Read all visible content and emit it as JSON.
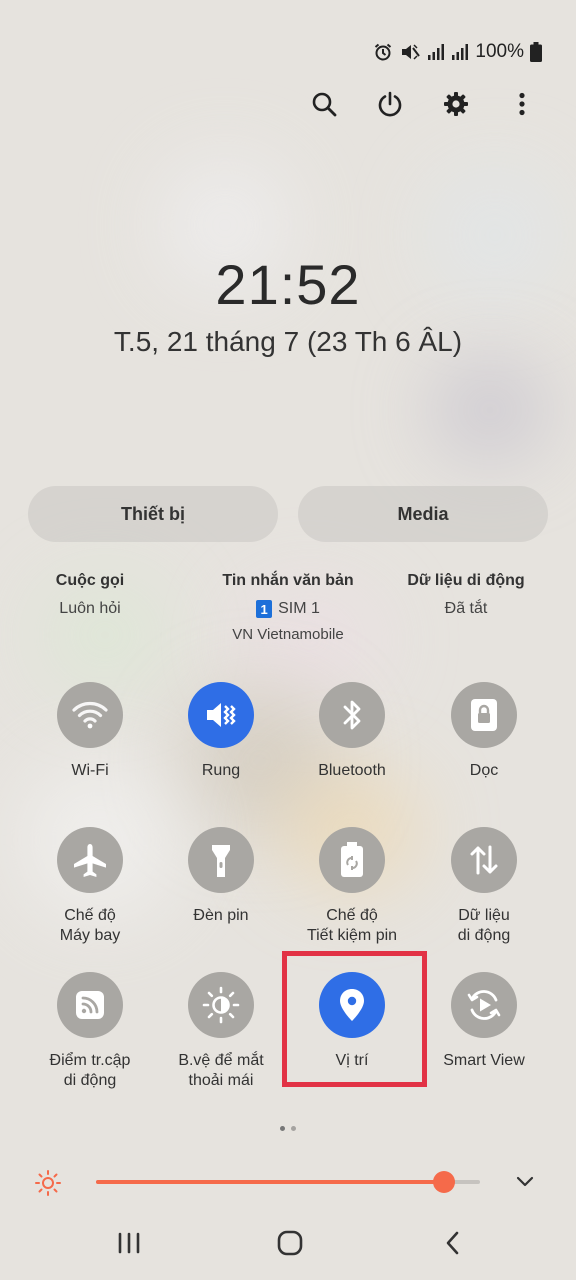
{
  "status": {
    "battery": "100%"
  },
  "clock": {
    "time": "21:52",
    "date": "T.5, 21 tháng 7 (23 Th 6 ÂL)"
  },
  "top_actions": [
    "search-icon",
    "power-icon",
    "gear-icon",
    "more-vert-icon"
  ],
  "tabs": {
    "devices": "Thiết bị",
    "media": "Media"
  },
  "sim_settings": {
    "calls": {
      "title": "Cuộc gọi",
      "value": "Luôn hỏi"
    },
    "messages": {
      "title": "Tin nhắn văn bản",
      "sim_number": "1",
      "value": "SIM 1",
      "network": "VN Vietnamobile"
    },
    "mobile_data": {
      "title": "Dữ liệu di động",
      "value": "Đã tắt"
    }
  },
  "tiles": [
    {
      "label": "Wi-Fi",
      "icon": "wifi-icon",
      "on": false
    },
    {
      "label": "Rung",
      "icon": "vibrate-icon",
      "on": true
    },
    {
      "label": "Bluetooth",
      "icon": "bluetooth-icon",
      "on": false
    },
    {
      "label": "Dọc",
      "icon": "portrait-lock-icon",
      "on": false
    },
    {
      "label": "Chế độ\nMáy bay",
      "icon": "airplane-icon",
      "on": false
    },
    {
      "label": "Đèn pin",
      "icon": "flashlight-icon",
      "on": false
    },
    {
      "label": "Chế độ\nTiết kiệm pin",
      "icon": "battery-saver-icon",
      "on": false
    },
    {
      "label": "Dữ liệu\ndi động",
      "icon": "mobile-data-icon",
      "on": false
    },
    {
      "label": "Điểm tr.cập\ndi động",
      "icon": "hotspot-icon",
      "on": false
    },
    {
      "label": "B.vệ để mắt\nthoải mái",
      "icon": "eye-comfort-icon",
      "on": false
    },
    {
      "label": "Vị trí",
      "icon": "location-icon",
      "on": true
    },
    {
      "label": "Smart View",
      "icon": "smart-view-icon",
      "on": false
    }
  ],
  "page_indicator": {
    "pages": 2,
    "current": 1
  },
  "brightness": {
    "level": 0.905
  },
  "colors": {
    "accent_blue": "#2f6ee6",
    "brightness_orange": "#f56a4a",
    "highlight_red": "#e23245"
  }
}
